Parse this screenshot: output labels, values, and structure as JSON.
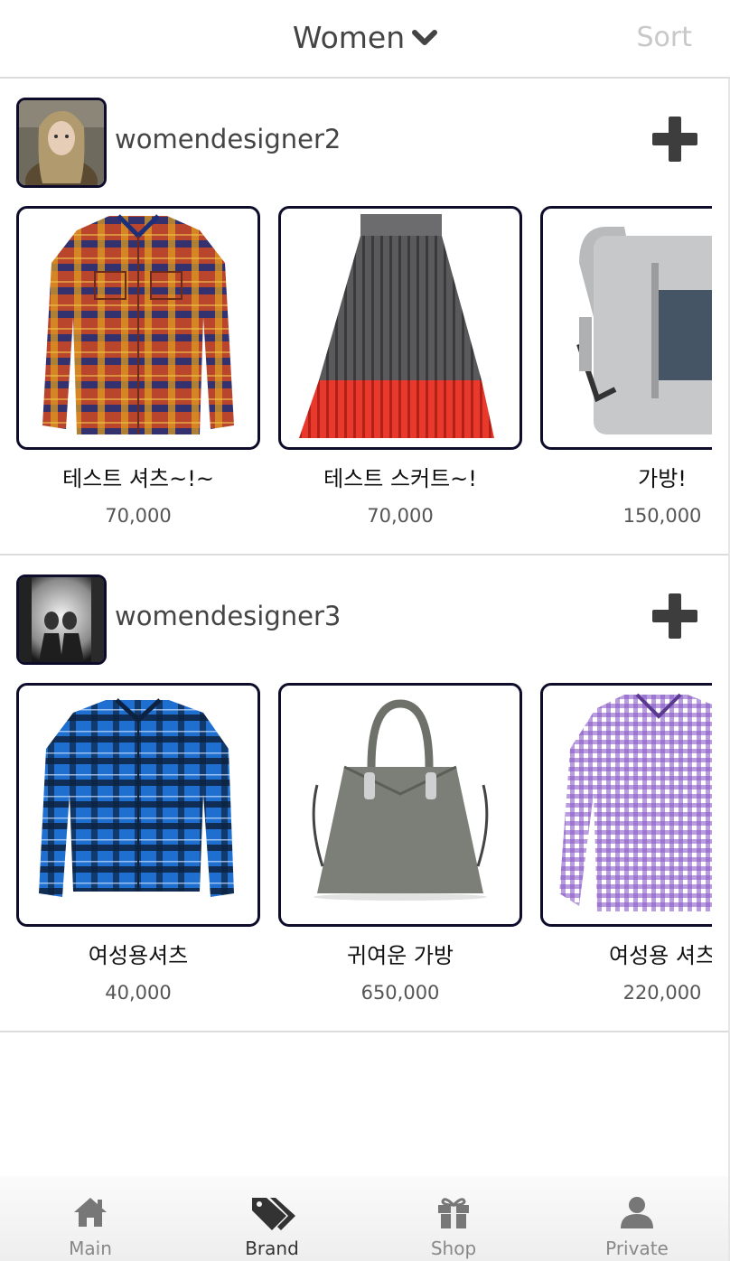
{
  "header": {
    "title": "Women",
    "sort_label": "Sort"
  },
  "sections": [
    {
      "designer": "womendesigner2",
      "products": [
        {
          "name": "테스트 셔츠~!~",
          "price": "70,000"
        },
        {
          "name": "테스트 스커트~!",
          "price": "70,000"
        },
        {
          "name": "가방!",
          "price": "150,000"
        }
      ]
    },
    {
      "designer": "womendesigner3",
      "products": [
        {
          "name": "여성용셔츠",
          "price": "40,000"
        },
        {
          "name": "귀여운 가방",
          "price": "650,000"
        },
        {
          "name": "여성용 셔츠",
          "price": "220,000"
        }
      ]
    }
  ],
  "tabbar": {
    "items": [
      {
        "label": "Main",
        "icon": "home-icon"
      },
      {
        "label": "Brand",
        "icon": "tags-icon",
        "active": true
      },
      {
        "label": "Shop",
        "icon": "gift-icon"
      },
      {
        "label": "Private",
        "icon": "user-icon"
      }
    ]
  }
}
